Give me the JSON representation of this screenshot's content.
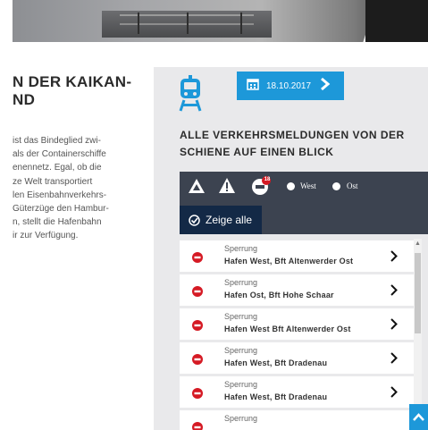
{
  "article": {
    "title_lines": [
      "N DER KAIKAN-",
      "ND"
    ],
    "body_lines": [
      "ist das Bindeglied zwi-",
      "als der Containerschiffe",
      "enennetz. Egal, ob die",
      "ze Welt transportiert",
      "len Eisenbahnverkehrs-",
      "Güterzüge den Hambur-",
      "n, stellt die Hafenbahn",
      "ir zur Verfügung."
    ]
  },
  "panel": {
    "date": "18.10.2017",
    "heading_lines": [
      "ALLE VERKEHRSMELDUNGEN VON DER",
      "SCHIENE AUF EINEN BLICK"
    ],
    "filters": {
      "badge_count": "18",
      "radio_west": "West",
      "radio_ost": "Ost",
      "show_all": "Zeige alle"
    },
    "messages": [
      {
        "type": "Sperrung",
        "location": "Hafen West, Bft Altenwerder Ost"
      },
      {
        "type": "Sperrung",
        "location": "Hafen Ost, Bft Hohe Schaar"
      },
      {
        "type": "Sperrung",
        "location": "Hafen West  Bft Altenwerder Ost"
      },
      {
        "type": "Sperrung",
        "location": "Hafen West, Bft Dradenau"
      },
      {
        "type": "Sperrung",
        "location": "Hafen West, Bft Dradenau"
      },
      {
        "type": "Sperrung",
        "location": ""
      }
    ]
  },
  "colors": {
    "accent": "#1d98d9",
    "panel_bg": "#e9e9eb",
    "filter_bg": "#3c4350",
    "show_all_bg": "#132946",
    "stop_red": "#d51a24"
  },
  "icons": [
    "train-icon",
    "calendar-icon",
    "chevron-right-icon",
    "warning-triangle-icon",
    "warning-icon",
    "no-entry-icon",
    "check-circle-icon",
    "arrow-right-icon",
    "arrow-up-icon"
  ]
}
